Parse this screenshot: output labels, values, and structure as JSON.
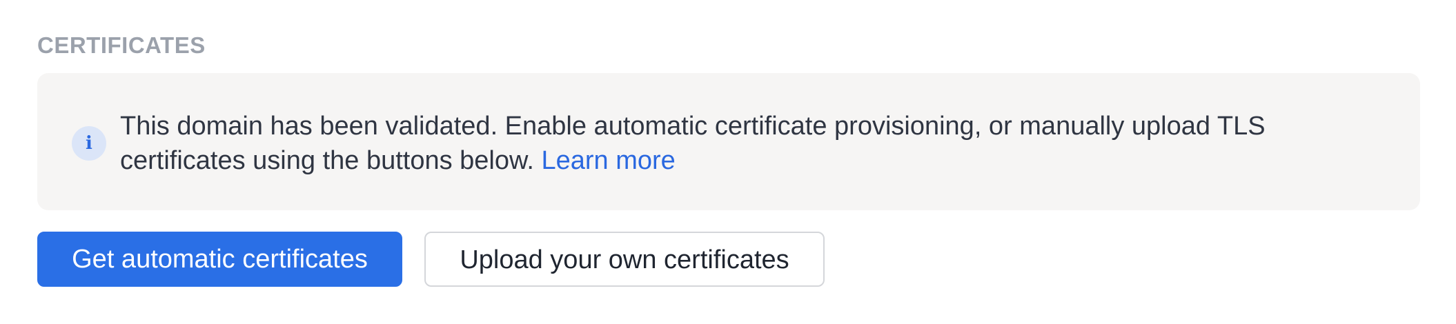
{
  "section": {
    "title": "CERTIFICATES"
  },
  "info": {
    "icon": "info-icon",
    "icon_glyph": "i",
    "message": "This domain has been validated. Enable automatic certificate provisioning, or manually upload TLS certificates using the buttons below.",
    "link_label": "Learn more"
  },
  "actions": {
    "primary_label": "Get automatic certificates",
    "secondary_label": "Upload your own certificates"
  },
  "colors": {
    "accent": "#2a6fe6",
    "link": "#2a68e0",
    "info_background": "#f6f5f4",
    "section_title": "#9ba1ab",
    "body_text": "#2f3542"
  }
}
